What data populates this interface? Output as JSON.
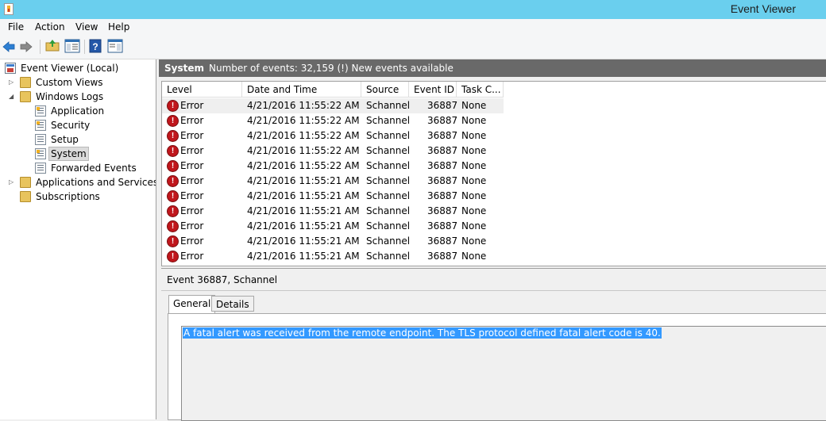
{
  "window": {
    "title": "Event Viewer"
  },
  "menu": [
    "File",
    "Action",
    "View",
    "Help"
  ],
  "toolbar": {
    "icons": [
      "back-arrow-icon",
      "forward-arrow-icon",
      "up-folder-icon",
      "show-hide-tree-icon",
      "help-icon",
      "show-hide-action-pane-icon"
    ]
  },
  "tree": {
    "root": "Event Viewer (Local)",
    "custom_views": "Custom Views",
    "windows_logs": "Windows Logs",
    "logs": [
      "Application",
      "Security",
      "Setup",
      "System",
      "Forwarded Events"
    ],
    "apps_services": "Applications and Services Lo",
    "subscriptions": "Subscriptions"
  },
  "header": {
    "title": "System",
    "count": "Number of events: 32,159 (!) New events available"
  },
  "grid": {
    "columns": [
      "Level",
      "Date and Time",
      "Source",
      "Event ID",
      "Task C..."
    ],
    "rows": [
      {
        "level": "Error",
        "datetime": "4/21/2016 11:55:22 AM",
        "source": "Schannel",
        "event_id": "36887",
        "task": "None"
      },
      {
        "level": "Error",
        "datetime": "4/21/2016 11:55:22 AM",
        "source": "Schannel",
        "event_id": "36887",
        "task": "None"
      },
      {
        "level": "Error",
        "datetime": "4/21/2016 11:55:22 AM",
        "source": "Schannel",
        "event_id": "36887",
        "task": "None"
      },
      {
        "level": "Error",
        "datetime": "4/21/2016 11:55:22 AM",
        "source": "Schannel",
        "event_id": "36887",
        "task": "None"
      },
      {
        "level": "Error",
        "datetime": "4/21/2016 11:55:22 AM",
        "source": "Schannel",
        "event_id": "36887",
        "task": "None"
      },
      {
        "level": "Error",
        "datetime": "4/21/2016 11:55:21 AM",
        "source": "Schannel",
        "event_id": "36887",
        "task": "None"
      },
      {
        "level": "Error",
        "datetime": "4/21/2016 11:55:21 AM",
        "source": "Schannel",
        "event_id": "36887",
        "task": "None"
      },
      {
        "level": "Error",
        "datetime": "4/21/2016 11:55:21 AM",
        "source": "Schannel",
        "event_id": "36887",
        "task": "None"
      },
      {
        "level": "Error",
        "datetime": "4/21/2016 11:55:21 AM",
        "source": "Schannel",
        "event_id": "36887",
        "task": "None"
      },
      {
        "level": "Error",
        "datetime": "4/21/2016 11:55:21 AM",
        "source": "Schannel",
        "event_id": "36887",
        "task": "None"
      },
      {
        "level": "Error",
        "datetime": "4/21/2016 11:55:21 AM",
        "source": "Schannel",
        "event_id": "36887",
        "task": "None"
      }
    ]
  },
  "detail": {
    "title": "Event 36887, Schannel",
    "tabs": [
      "General",
      "Details"
    ],
    "description": "A fatal alert was received from the remote endpoint. The TLS protocol defined fatal alert code is 40."
  }
}
